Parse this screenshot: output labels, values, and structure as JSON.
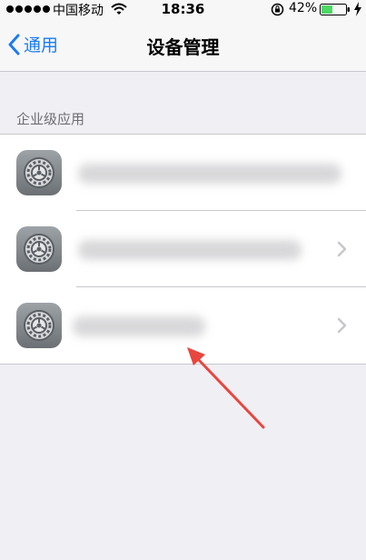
{
  "status_bar": {
    "carrier": "中国移动",
    "time": "18:36",
    "battery_percent": "42%"
  },
  "nav": {
    "back_label": "通用",
    "title": "设备管理"
  },
  "section": {
    "header": "企业级应用"
  },
  "apps": [
    {
      "icon": "settings-gear-icon",
      "name_blurred": true,
      "has_chevron": false
    },
    {
      "icon": "settings-gear-icon",
      "name_blurred": true,
      "has_chevron": true
    },
    {
      "icon": "settings-gear-icon",
      "name_blurred": true,
      "has_chevron": true
    }
  ],
  "colors": {
    "accent": "#1b7cf0",
    "annotation_arrow": "#e8463f",
    "background": "#efeff4"
  }
}
